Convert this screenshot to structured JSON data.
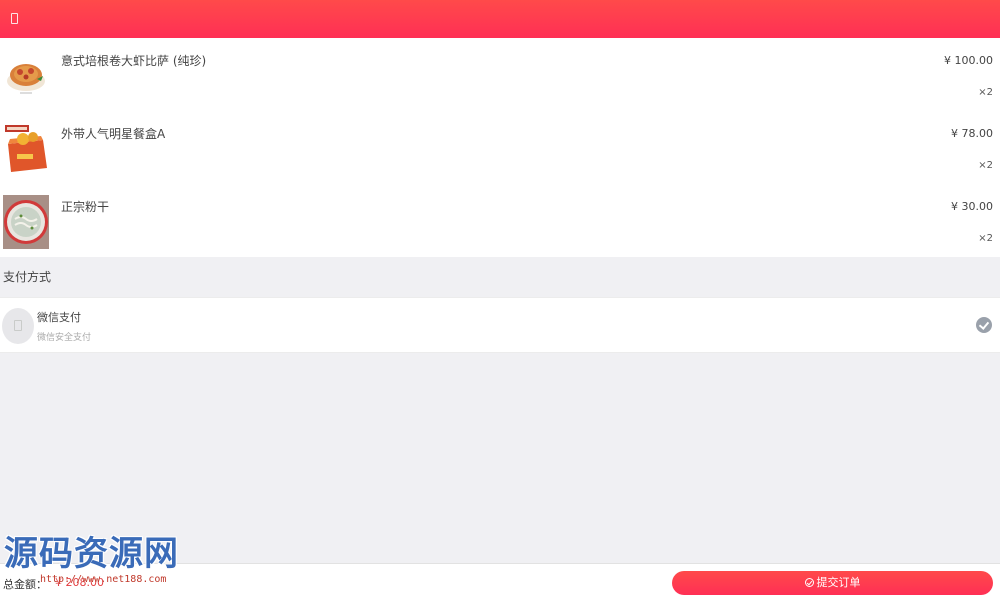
{
  "header": {
    "back_icon": "back-icon"
  },
  "order": {
    "items": [
      {
        "name": "意式培根卷大虾比萨 (纯珍)",
        "price": "¥ 100.00",
        "qty": "×2"
      },
      {
        "name": "外带人气明星餐盒A",
        "price": "¥ 78.00",
        "qty": "×2"
      },
      {
        "name": "正宗粉干",
        "price": "¥ 30.00",
        "qty": "×2"
      }
    ]
  },
  "payment": {
    "section_title": "支付方式",
    "method_name": "微信支付",
    "method_desc": "微信安全支付",
    "selected": true
  },
  "footer": {
    "total_label": "总金额：",
    "total_value": "¥ 208.00",
    "submit_label": "提交订单"
  },
  "watermark": {
    "title": "源码资源网",
    "url": "http://www.net188.com"
  },
  "colors": {
    "brand": "#ff3b4f",
    "accent_text": "#e4393c",
    "background": "#f0f0f3",
    "check": "#9aa1ab"
  }
}
